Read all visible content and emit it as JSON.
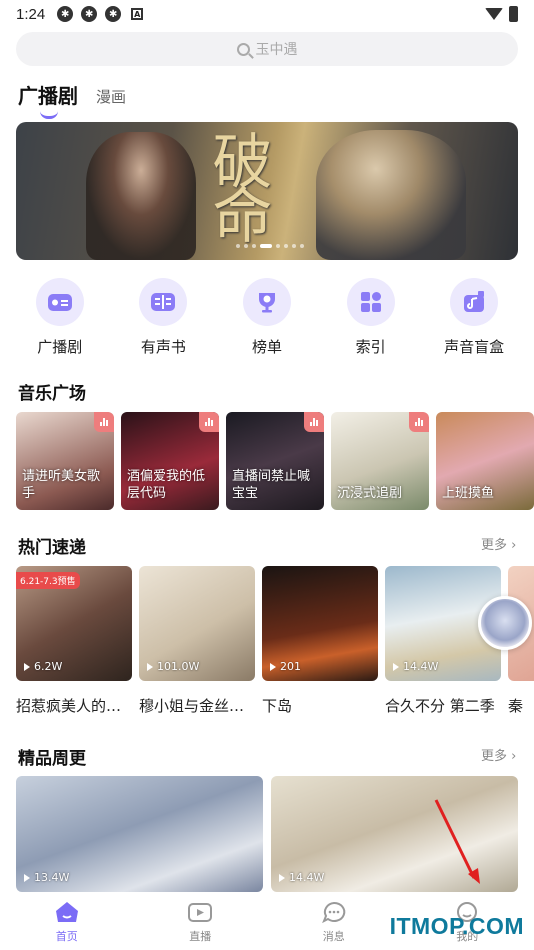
{
  "status_bar": {
    "time": "1:24"
  },
  "search": {
    "placeholder": "玉中遇"
  },
  "tabs": [
    {
      "label": "广播剧",
      "active": true
    },
    {
      "label": "漫画",
      "active": false
    }
  ],
  "banner": {
    "title_art": "破命",
    "dots": 8,
    "active_dot": 3
  },
  "quick_nav": [
    {
      "label": "广播剧",
      "icon": "radio-icon"
    },
    {
      "label": "有声书",
      "icon": "book-icon"
    },
    {
      "label": "榜单",
      "icon": "trophy-icon"
    },
    {
      "label": "索引",
      "icon": "index-icon"
    },
    {
      "label": "声音盲盒",
      "icon": "blindbox-icon"
    }
  ],
  "music_section": {
    "title": "音乐广场",
    "items": [
      {
        "label": "请进听美女歌手",
        "color": "#b78b7a"
      },
      {
        "label": "酒偏爱我的低层代码",
        "color": "#6b2a3a"
      },
      {
        "label": "直播间禁止喊宝宝",
        "color": "#3a2c3a"
      },
      {
        "label": "沉浸式追剧",
        "color": "#cfc9b6"
      },
      {
        "label": "上班摸鱼",
        "color": "#d2a85c"
      }
    ]
  },
  "hot_section": {
    "title": "热门速递",
    "more": "更多",
    "items": [
      {
        "title": "招惹疯美人的…",
        "plays": "6.2W",
        "badge": "6.21-7.3预售",
        "color": "#7a5d4e"
      },
      {
        "title": "穆小姐与金丝…",
        "plays": "101.0W",
        "badge": "",
        "color": "#d9cdbb"
      },
      {
        "title": "下岛",
        "plays": "201",
        "badge": "",
        "color": "#3b2217"
      },
      {
        "title": "合久不分 第二季",
        "plays": "14.4W",
        "badge": "",
        "color": "#c9d6df"
      },
      {
        "title": "秦",
        "plays": "",
        "badge": "",
        "color": "#e2a39a"
      }
    ]
  },
  "weekly_section": {
    "title": "精品周更",
    "more": "更多",
    "items": [
      {
        "plays": "13.4W",
        "color": "#9aa9be"
      },
      {
        "plays": "14.4W",
        "color": "#d9d1bf"
      }
    ]
  },
  "bottom_nav": [
    {
      "label": "首页",
      "active": true
    },
    {
      "label": "直播",
      "active": false
    },
    {
      "label": "消息",
      "active": false
    },
    {
      "label": "我的",
      "active": false
    }
  ],
  "watermark": "ITMOP.COM",
  "colors": {
    "accent": "#7b6cf6",
    "accent_light": "#ece9fd"
  }
}
